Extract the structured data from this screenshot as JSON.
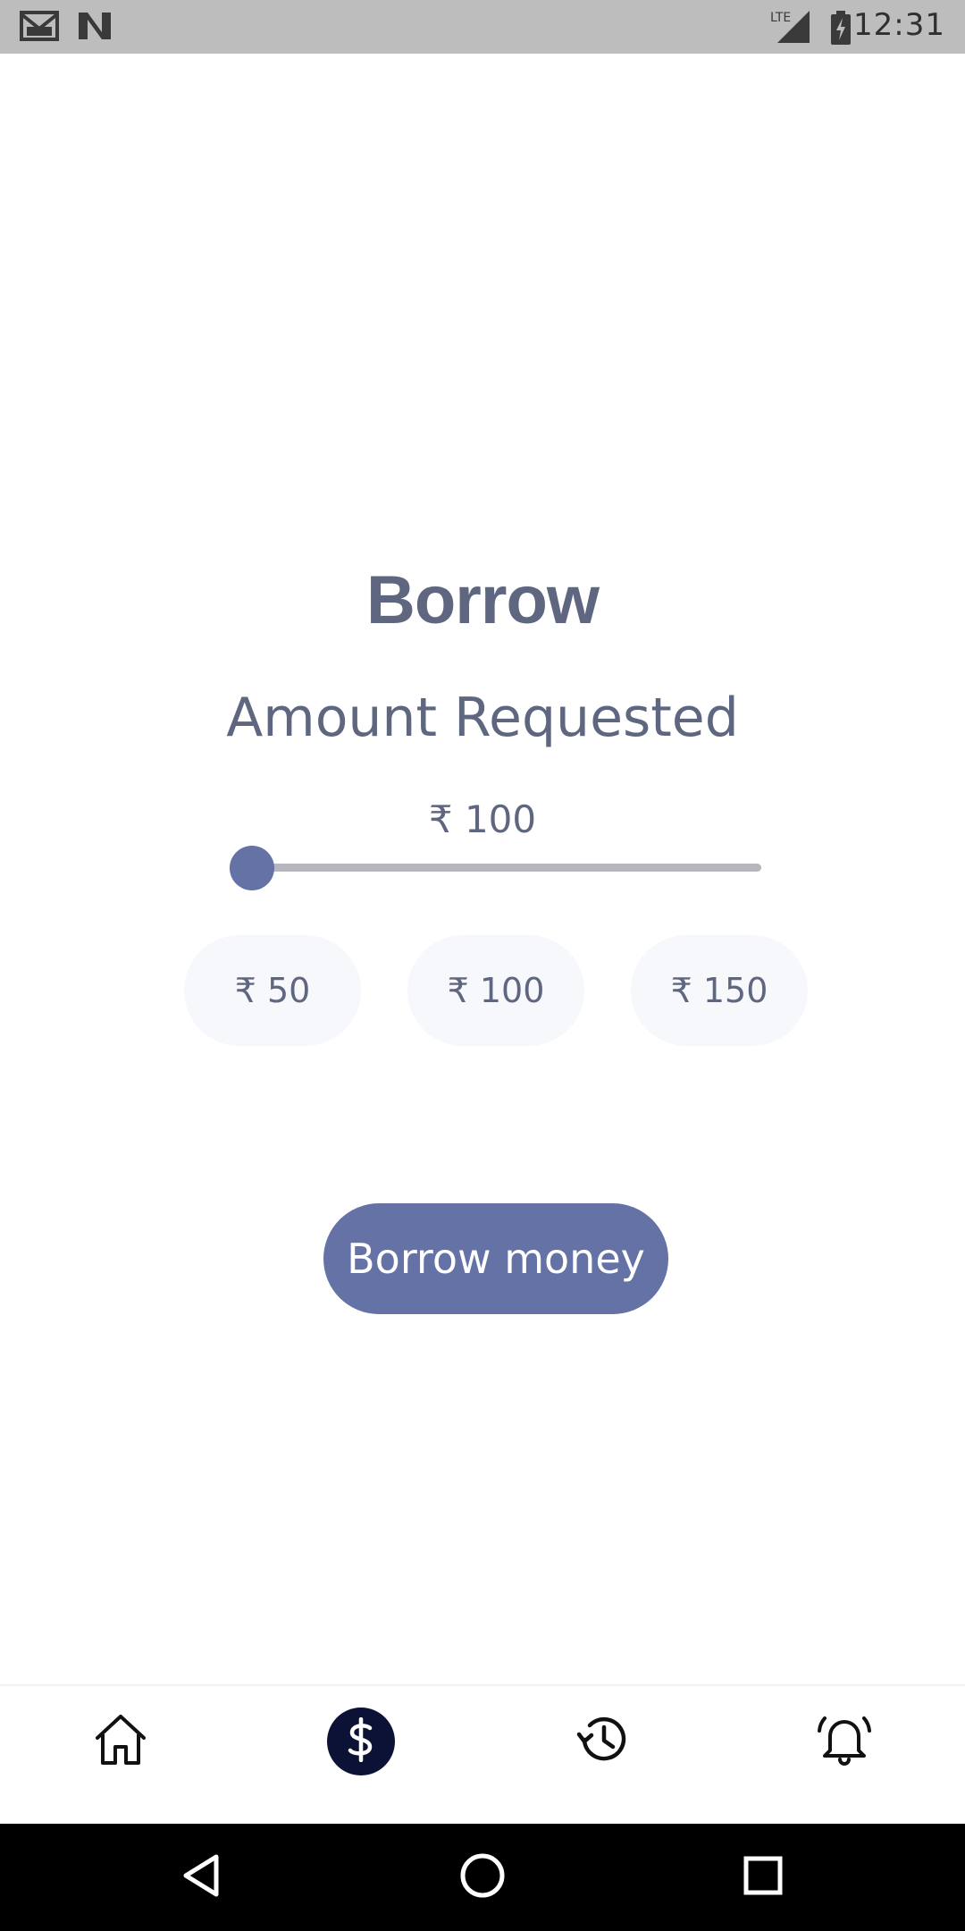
{
  "status_bar": {
    "time": "12:31",
    "icons": [
      "gmail-icon",
      "n-app-icon",
      "lte-signal-icon",
      "battery-charging-icon"
    ],
    "network_label": "LTE"
  },
  "main": {
    "title": "Borrow",
    "subtitle": "Amount Requested",
    "amount_display": "₹ 100",
    "slider": {
      "value_fraction": 0.0
    },
    "quick_amounts": [
      "₹ 50",
      "₹ 100",
      "₹ 150"
    ],
    "primary_button": "Borrow money"
  },
  "bottom_nav": {
    "items": [
      {
        "icon": "home-icon",
        "active": false
      },
      {
        "icon": "dollar-icon",
        "active": true
      },
      {
        "icon": "history-icon",
        "active": false
      },
      {
        "icon": "alarm-bell-icon",
        "active": false
      }
    ]
  },
  "system_nav": [
    "back-icon",
    "home-circle-icon",
    "recents-icon"
  ],
  "colors": {
    "accent": "#6472a6",
    "text": "#5f6680",
    "chip_bg": "#f7f8fc",
    "active_nav": "#0b1236",
    "status_bar": "#bdbdbd"
  }
}
